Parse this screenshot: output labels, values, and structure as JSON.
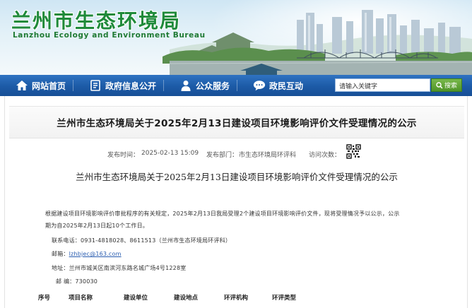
{
  "site": {
    "title": "兰州市生态环境局",
    "subtitle": "Lanzhou Ecology and Environment Bureau"
  },
  "nav": {
    "items": [
      {
        "label": "网站首页",
        "icon": "home-icon"
      },
      {
        "label": "政府信息公开",
        "icon": "document-icon"
      },
      {
        "label": "公众服务",
        "icon": "person-icon"
      },
      {
        "label": "政民互动",
        "icon": "chat-bubble-icon"
      }
    ],
    "search_placeholder": "请输入关键字",
    "search_button": "搜索",
    "colors": {
      "nav_bg": "#1c5aa6",
      "search_button": "#4f9428",
      "title_green": "#1f8a3a"
    }
  },
  "article": {
    "title": "兰州市生态环境局关于2025年2月13日建设项目环境影响评价文件受理情况的公示",
    "publish_label": "发布时间：",
    "publish_time": "2025-02-13 15:09",
    "dept_label": "发布部门：",
    "dept": "市生态环境局环评科",
    "views_label": "访问次数：",
    "doc_title": "兰州市生态环境局关于2025年2月13日建设项目环境影响评价文件受理情况的公示",
    "para1_line1": "根据建设项目环境影响评价审批程序的有关规定，2025年2月13日我局受理2个建设项目环境影响评价文件，现将受理情况予以公示，公示",
    "para1_line2": "期为自2025年2月13日起10个工作日。",
    "phone_label": "联系电话：",
    "phone": "0931-4818028、8611513（兰州市生态环境局环评科）",
    "email_label": "邮箱：",
    "email": "lzhbjec@163.com",
    "address_label": "地址：",
    "address": "兰州市城关区南滨河东路名城广场4号1228室",
    "postcode_label": "邮   编：",
    "postcode": "730030"
  },
  "table": {
    "headers": [
      "序号",
      "项目名称",
      "建设单位",
      "建设地点",
      "环评机构",
      "环评类型"
    ]
  }
}
